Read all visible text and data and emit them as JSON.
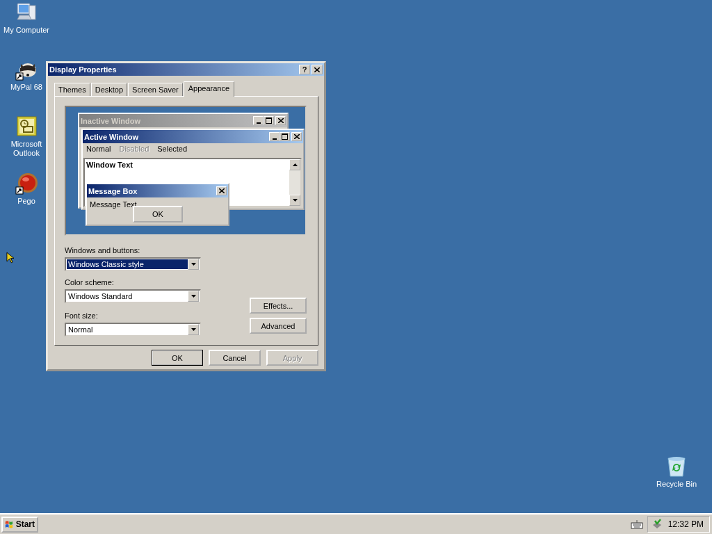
{
  "desktop_icons": [
    {
      "kind": "computer",
      "label": "My Computer"
    },
    {
      "kind": "raccoon",
      "label": "MyPal 68",
      "shortcut": true
    },
    {
      "kind": "outlook",
      "label": "Microsoft Outlook"
    },
    {
      "kind": "ball",
      "label": "Pego",
      "shortcut": true
    },
    {
      "kind": "recycle",
      "label": "Recycle Bin"
    }
  ],
  "dialog": {
    "title": "Display Properties",
    "help": "?",
    "tabs": [
      {
        "label": "Themes",
        "selected": false
      },
      {
        "label": "Desktop",
        "selected": false
      },
      {
        "label": "Screen Saver",
        "selected": false
      },
      {
        "label": "Appearance",
        "selected": true
      }
    ],
    "preview": {
      "inactive_title": "Inactive Window",
      "active_title": "Active Window",
      "menu": [
        {
          "label": "Normal",
          "disabled": false
        },
        {
          "label": "Disabled",
          "disabled": true
        },
        {
          "label": "Selected",
          "disabled": false
        }
      ],
      "window_text": "Window Text",
      "message_title": "Message Box",
      "message_text": "Message Text",
      "message_button": "OK"
    },
    "fields": [
      {
        "label": "Windows and buttons:",
        "value": "Windows Classic style",
        "focused": true
      },
      {
        "label": "Color scheme:",
        "value": "Windows Standard",
        "focused": false
      },
      {
        "label": "Font size:",
        "value": "Normal",
        "focused": false
      }
    ],
    "side_buttons": [
      "Effects...",
      "Advanced"
    ],
    "buttons": [
      {
        "label": "OK",
        "default": true,
        "disabled": false
      },
      {
        "label": "Cancel",
        "default": false,
        "disabled": false
      },
      {
        "label": "Apply",
        "default": false,
        "disabled": true
      }
    ]
  },
  "taskbar": {
    "start": "Start",
    "clock": "12:32 PM"
  }
}
